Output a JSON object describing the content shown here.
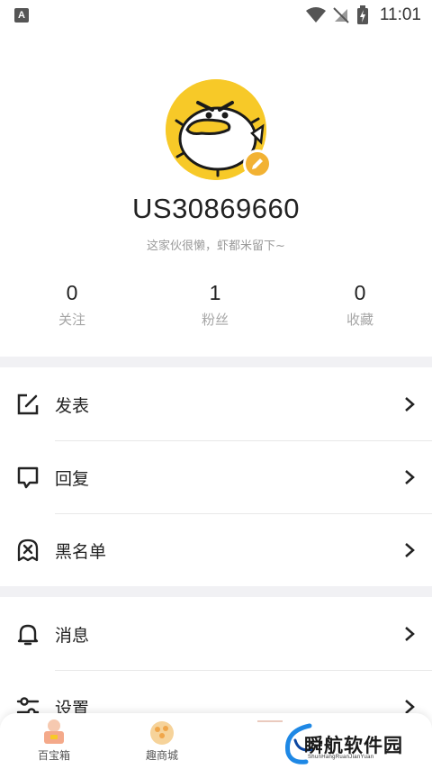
{
  "status_bar": {
    "app_indicator": "A",
    "time": "11:01"
  },
  "profile": {
    "username": "US30869660",
    "signature": "这家伙很懒，虾都米留下~"
  },
  "stats": [
    {
      "value": "0",
      "label": "关注"
    },
    {
      "value": "1",
      "label": "粉丝"
    },
    {
      "value": "0",
      "label": "收藏"
    }
  ],
  "menu": {
    "group1": [
      {
        "label": "发表",
        "icon": "edit-icon"
      },
      {
        "label": "回复",
        "icon": "comment-icon"
      },
      {
        "label": "黑名单",
        "icon": "blacklist-icon"
      }
    ],
    "group2": [
      {
        "label": "消息",
        "icon": "bell-icon"
      },
      {
        "label": "设置",
        "icon": "settings-icon"
      }
    ]
  },
  "tabbar": {
    "tabs": [
      {
        "label": "百宝箱",
        "icon": "treasure-box-icon"
      },
      {
        "label": "趣商城",
        "icon": "shop-icon"
      }
    ]
  },
  "watermark": {
    "title": "瞬航软件园",
    "subtitle": "ShunHangRuanJianYuan"
  },
  "colors": {
    "accent": "#f7c928",
    "badge": "#f2b233",
    "band": "#f1f1f4"
  }
}
